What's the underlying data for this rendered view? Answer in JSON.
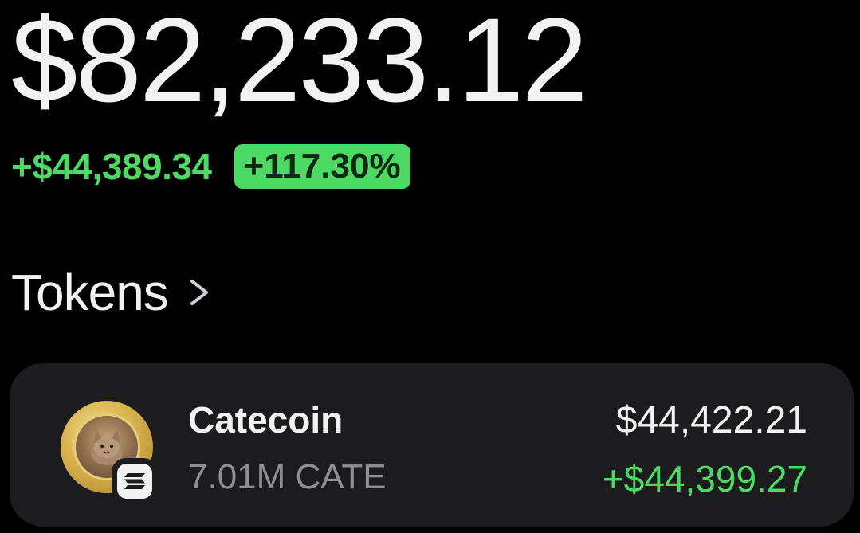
{
  "portfolio": {
    "balance": "$82,233.12",
    "change_amount": "+$44,389.34",
    "change_percent": "+117.30%"
  },
  "tokens_section": {
    "title": "Tokens",
    "chevron_icon": "chevron-right-icon"
  },
  "tokens": [
    {
      "name": "Catecoin",
      "amount": "7.01M CATE",
      "value": "$44,422.21",
      "change": "+$44,399.27",
      "icon": "catecoin-token-icon",
      "chain_icon": "solana-chain-icon"
    }
  ],
  "colors": {
    "background": "#000000",
    "card": "#1c1c1e",
    "positive": "#4cd964",
    "text_primary": "#f2f2f2",
    "text_secondary": "#8e8e93"
  }
}
